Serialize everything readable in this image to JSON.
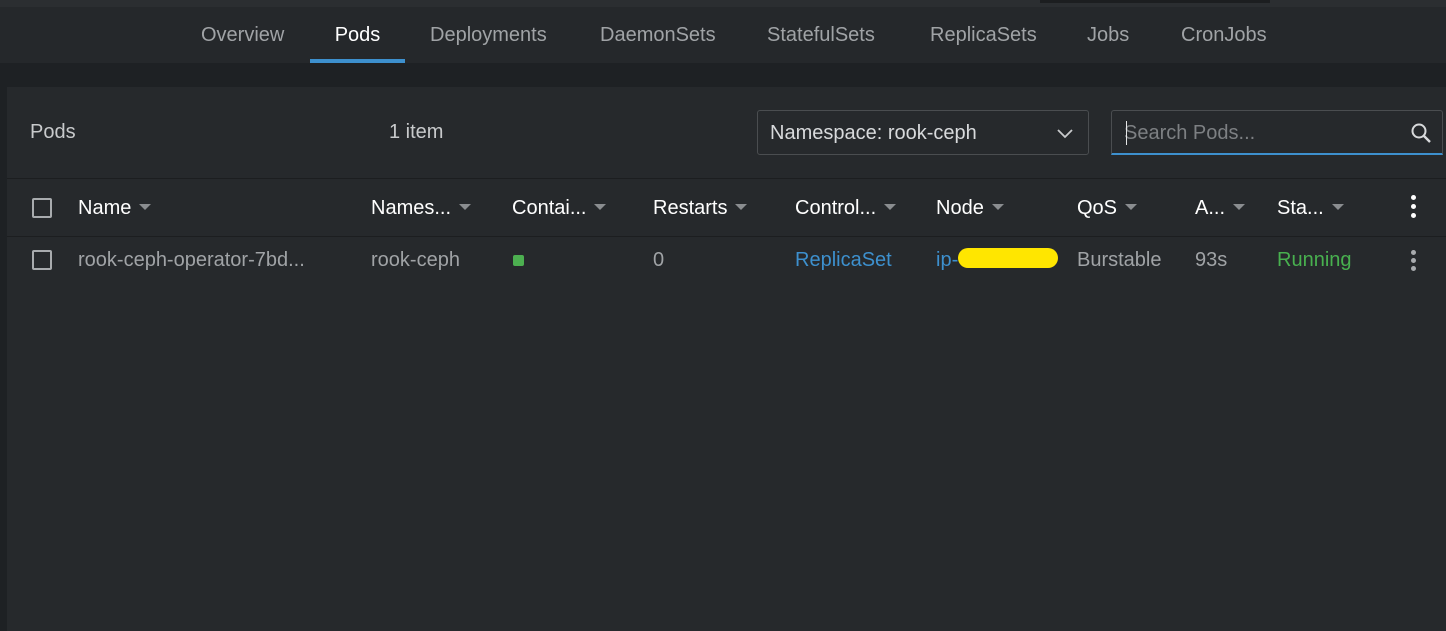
{
  "tabs": [
    {
      "label": "Overview",
      "active": false
    },
    {
      "label": "Pods",
      "active": true
    },
    {
      "label": "Deployments",
      "active": false
    },
    {
      "label": "DaemonSets",
      "active": false
    },
    {
      "label": "StatefulSets",
      "active": false
    },
    {
      "label": "ReplicaSets",
      "active": false
    },
    {
      "label": "Jobs",
      "active": false
    },
    {
      "label": "CronJobs",
      "active": false
    }
  ],
  "panel": {
    "title": "Pods",
    "item_count": "1 item",
    "namespace_select": "Namespace: rook-ceph",
    "search_placeholder": "Search Pods..."
  },
  "table": {
    "columns": [
      "Name",
      "Names...",
      "Contai...",
      "Restarts",
      "Control...",
      "Node",
      "QoS",
      "A...",
      "Sta..."
    ],
    "rows": [
      {
        "name": "rook-ceph-operator-7bd...",
        "namespace": "rook-ceph",
        "container_status": "running",
        "restarts": "0",
        "controlled_by": "ReplicaSet",
        "node": "ip-",
        "qos": "Burstable",
        "age": "93s",
        "status": "Running"
      }
    ]
  },
  "colors": {
    "accent": "#3d90ce",
    "running": "#48b04f",
    "redaction": "#ffe600"
  },
  "icons": {
    "dropdown": "chevron-down-icon",
    "search": "search-icon",
    "menu": "more-vertical-icon"
  }
}
